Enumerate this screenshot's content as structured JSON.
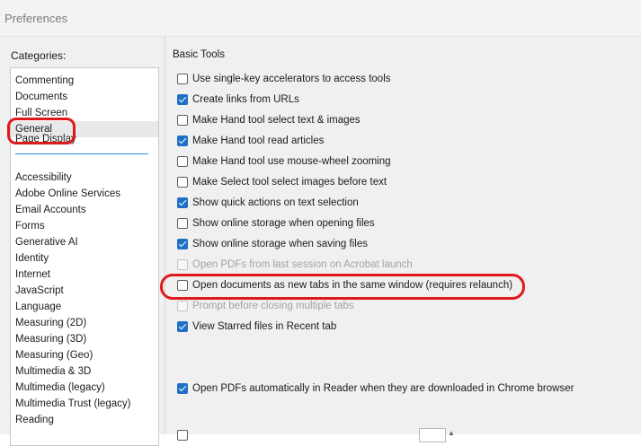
{
  "window": {
    "title": "Preferences"
  },
  "sidebar": {
    "label": "Categories:",
    "top_items": [
      "Commenting",
      "Documents",
      "Full Screen",
      "General",
      "Page Display"
    ],
    "selected": "General",
    "items": [
      "Accessibility",
      "Adobe Online Services",
      "Email Accounts",
      "Forms",
      "Generative AI",
      "Identity",
      "Internet",
      "JavaScript",
      "Language",
      "Measuring (2D)",
      "Measuring (3D)",
      "Measuring (Geo)",
      "Multimedia & 3D",
      "Multimedia (legacy)",
      "Multimedia Trust (legacy)",
      "Reading"
    ]
  },
  "basic_tools": {
    "title": "Basic Tools",
    "options": [
      {
        "label": "Use single-key accelerators to access tools",
        "checked": false,
        "enabled": true
      },
      {
        "label": "Create links from URLs",
        "checked": true,
        "enabled": true
      },
      {
        "label": "Make Hand tool select text & images",
        "checked": false,
        "enabled": true
      },
      {
        "label": "Make Hand tool read articles",
        "checked": true,
        "enabled": true
      },
      {
        "label": "Make Hand tool use mouse-wheel zooming",
        "checked": false,
        "enabled": true
      },
      {
        "label": "Make Select tool select images before text",
        "checked": false,
        "enabled": true
      },
      {
        "label": "Show quick actions on text selection",
        "checked": true,
        "enabled": true
      },
      {
        "label": "Show online storage when opening files",
        "checked": false,
        "enabled": true
      },
      {
        "label": "Show online storage when saving files",
        "checked": true,
        "enabled": true
      },
      {
        "label": "Open PDFs from last session on Acrobat launch",
        "checked": false,
        "enabled": false
      },
      {
        "label": "Open documents as new tabs in the same window (requires relaunch)",
        "checked": false,
        "enabled": true
      },
      {
        "label": "Prompt before closing multiple tabs",
        "checked": false,
        "enabled": false
      },
      {
        "label": "View Starred files in Recent tab",
        "checked": true,
        "enabled": true
      }
    ],
    "chrome_option": {
      "label": "Open PDFs automatically in Reader when they are downloaded in Chrome browser",
      "checked": true,
      "enabled": true
    }
  },
  "annotation_color": "#e0191b",
  "accent_color": "#1f6fc5"
}
